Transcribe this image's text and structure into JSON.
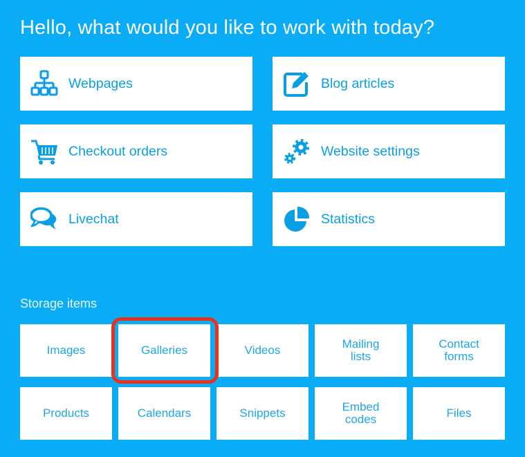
{
  "greeting": "Hello, what would you like to work with today?",
  "colors": {
    "background": "#0aacf5",
    "accent": "#0a9fe4",
    "highlight": "#e8321c"
  },
  "main_cards": [
    {
      "label": "Webpages",
      "icon": "sitemap-icon"
    },
    {
      "label": "Blog articles",
      "icon": "edit-icon"
    },
    {
      "label": "Checkout orders",
      "icon": "shopping-cart-icon"
    },
    {
      "label": "Website settings",
      "icon": "gears-icon"
    },
    {
      "label": "Livechat",
      "icon": "chat-bubbles-icon"
    },
    {
      "label": "Statistics",
      "icon": "pie-chart-icon"
    }
  ],
  "storage": {
    "title": "Storage items",
    "items": [
      {
        "label": "Images"
      },
      {
        "label": "Galleries"
      },
      {
        "label": "Videos"
      },
      {
        "label": "Mailing\nlists"
      },
      {
        "label": "Contact\nforms"
      },
      {
        "label": "Products"
      },
      {
        "label": "Calendars"
      },
      {
        "label": "Snippets"
      },
      {
        "label": "Embed\ncodes"
      },
      {
        "label": "Files"
      }
    ]
  }
}
